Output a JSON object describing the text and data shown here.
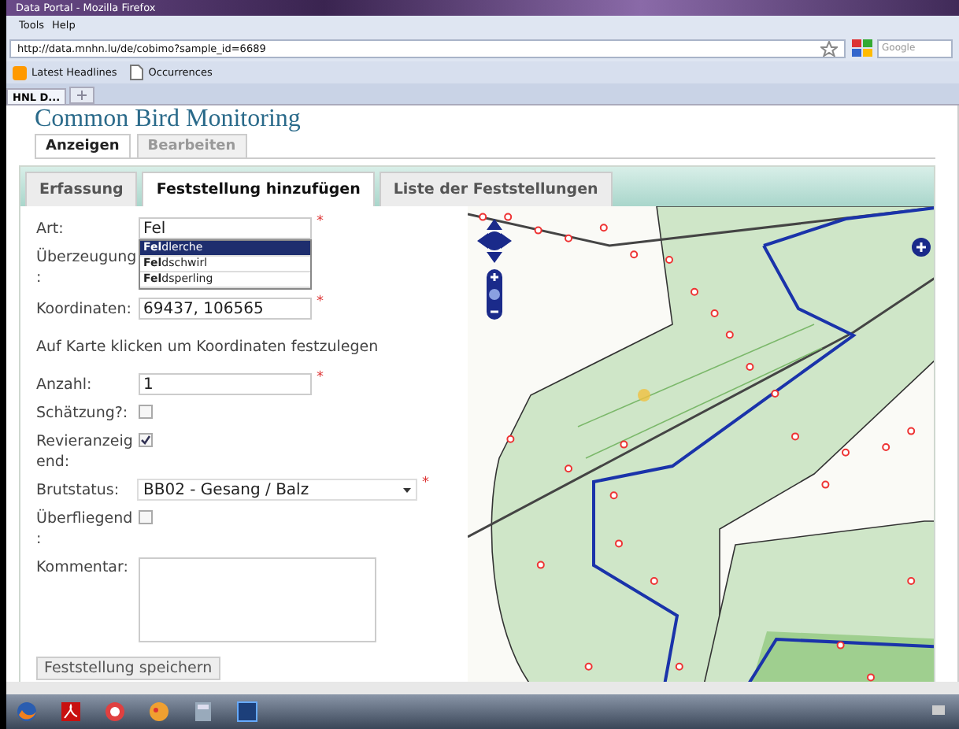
{
  "window": {
    "title": "Data Portal - Mozilla Firefox"
  },
  "menu": [
    "Tools",
    "Help"
  ],
  "address_bar": {
    "url": "http://data.mnhn.lu/de/cobimo?sample_id=6689"
  },
  "search_bar": {
    "placeholder": "Google"
  },
  "bookmarks": [
    "Latest Headlines",
    "Occurrences"
  ],
  "browser_tabs": [
    {
      "label": "HNL D...",
      "selected": true
    }
  ],
  "page": {
    "heading": "Common Bird Monitoring",
    "tabs": [
      {
        "label": "Anzeigen",
        "selected": true
      },
      {
        "label": "Bearbeiten",
        "selected": false
      }
    ],
    "subtabs": [
      {
        "label": "Erfassung",
        "selected": false
      },
      {
        "label": "Feststellung hinzufügen",
        "selected": true
      },
      {
        "label": "Liste der Feststellungen",
        "selected": false
      }
    ],
    "fields": [
      {
        "kind": "text",
        "label": "Art:",
        "value": "Fel",
        "required_mark": "*",
        "suggestions": [
          {
            "text": "**Fel**dlerche",
            "selected": true
          },
          {
            "text": "**Fel**dschwirl",
            "selected": false
          },
          {
            "text": "**Fel**dsperling",
            "selected": false
          }
        ]
      },
      {
        "kind": "hidden",
        "label": "Überzeugung :"
      },
      {
        "kind": "text",
        "label": "Koordinaten:",
        "value": "69437, 106565",
        "required_mark": "*"
      },
      {
        "kind": "note",
        "label": "Auf Karte klicken um Koordinaten festzulegen"
      },
      {
        "kind": "text",
        "label": "Anzahl:",
        "value": "1",
        "required_mark": "*"
      },
      {
        "kind": "checkbox",
        "label": "Schätzung?:",
        "checked": false
      },
      {
        "kind": "checkbox",
        "label": "Revieranzeigend:",
        "checked": true
      },
      {
        "kind": "select",
        "label": "Brutstatus:",
        "value": "BB02 - Gesang / Balz",
        "required_mark": "*"
      },
      {
        "kind": "checkbox",
        "label": "Überfliegend :",
        "checked": false
      },
      {
        "kind": "textarea",
        "label": "Kommentar:"
      }
    ],
    "submit": "Feststellung speichern"
  }
}
